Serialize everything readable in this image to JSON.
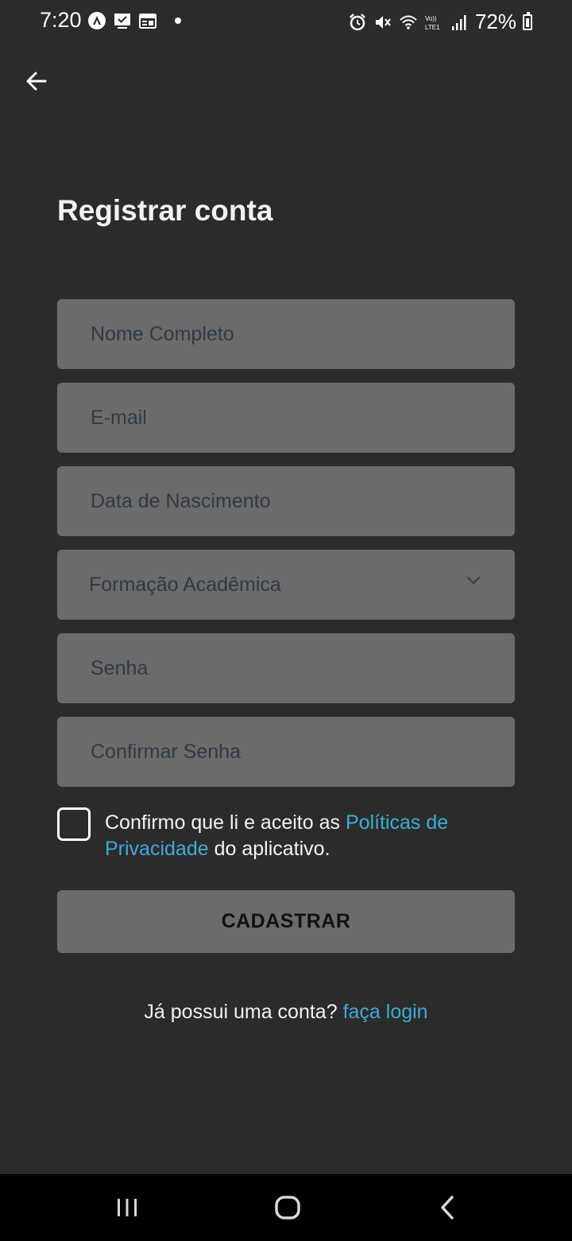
{
  "status_bar": {
    "time": "7:20",
    "battery": "72%",
    "left_icons": [
      "app-notification-icon",
      "checklist-icon",
      "calendar-icon",
      "dot-icon"
    ],
    "right_icons": [
      "alarm-icon",
      "mute-icon",
      "wifi-icon",
      "volte-lte-icon",
      "signal-icon",
      "battery-icon"
    ]
  },
  "header": {
    "title": "Registrar conta"
  },
  "form": {
    "full_name_placeholder": "Nome Completo",
    "email_placeholder": "E-mail",
    "birthdate_placeholder": "Data de Nascimento",
    "education_select": "Formação Acadêmica",
    "password_placeholder": "Senha",
    "confirm_password_placeholder": "Confirmar Senha"
  },
  "terms": {
    "prefix": "Confirmo que li e aceito as ",
    "link": "Políticas de Privacidade",
    "suffix": " do aplicativo."
  },
  "submit_label": "CADASTRAR",
  "login_prompt": {
    "text": "Já possui uma conta? ",
    "link": "faça login"
  },
  "colors": {
    "background": "#2b2b2b",
    "field": "#6b6b6b",
    "link": "#3aaed6",
    "nav_bar": "#000000"
  }
}
